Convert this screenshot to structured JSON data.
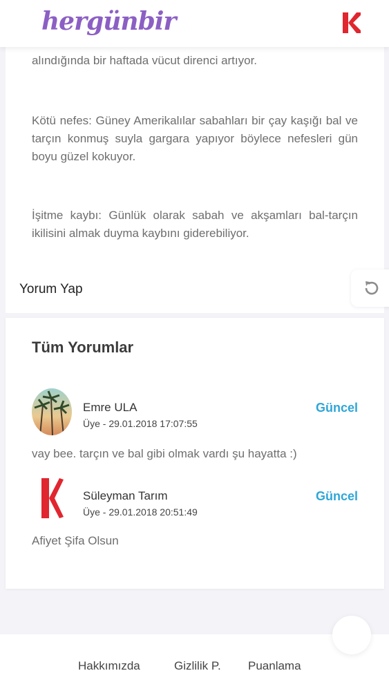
{
  "header": {
    "logo_text": "hergünbir",
    "brand_icon": "k-logo-icon"
  },
  "article": {
    "paragraphs": [
      "alındığında bir haftada vücut direnci artıyor.",
      "Kötü nefes: Güney Amerikalılar sabahları bir çay kaşığı bal ve tarçın konmuş suyla gargara yapıyor böylece nefesleri gün boyu güzel kokuyor.",
      "İşitme kaybı: Günlük olarak sabah ve akşamları bal-tarçın ikilisini almak duyma kaybını giderebiliyor."
    ]
  },
  "comment_section": {
    "title": "Yorum Yap",
    "refresh_icon": "refresh-icon"
  },
  "all_comments": {
    "title": "Tüm Yorumlar",
    "items": [
      {
        "author": "Emre ULA",
        "meta": "Üye - 29.01.2018 17:07:55",
        "status": "Güncel",
        "text": "vay bee. tarçın ve bal gibi olmak vardı şu hayatta :)",
        "avatar": "palm-tree-avatar"
      },
      {
        "author": "Süleyman Tarım",
        "meta": "Üye - 29.01.2018 20:51:49",
        "status": "Güncel",
        "text": "Afiyet Şifa Olsun",
        "avatar": "k-logo-avatar"
      }
    ]
  },
  "footer": {
    "links": [
      "Hakkımızda",
      "Gizlilik P.",
      "Puanlama"
    ]
  },
  "colors": {
    "logo": "#8c5fc4",
    "brand_red": "#e0262f",
    "status_blue": "#2ea6d8"
  }
}
